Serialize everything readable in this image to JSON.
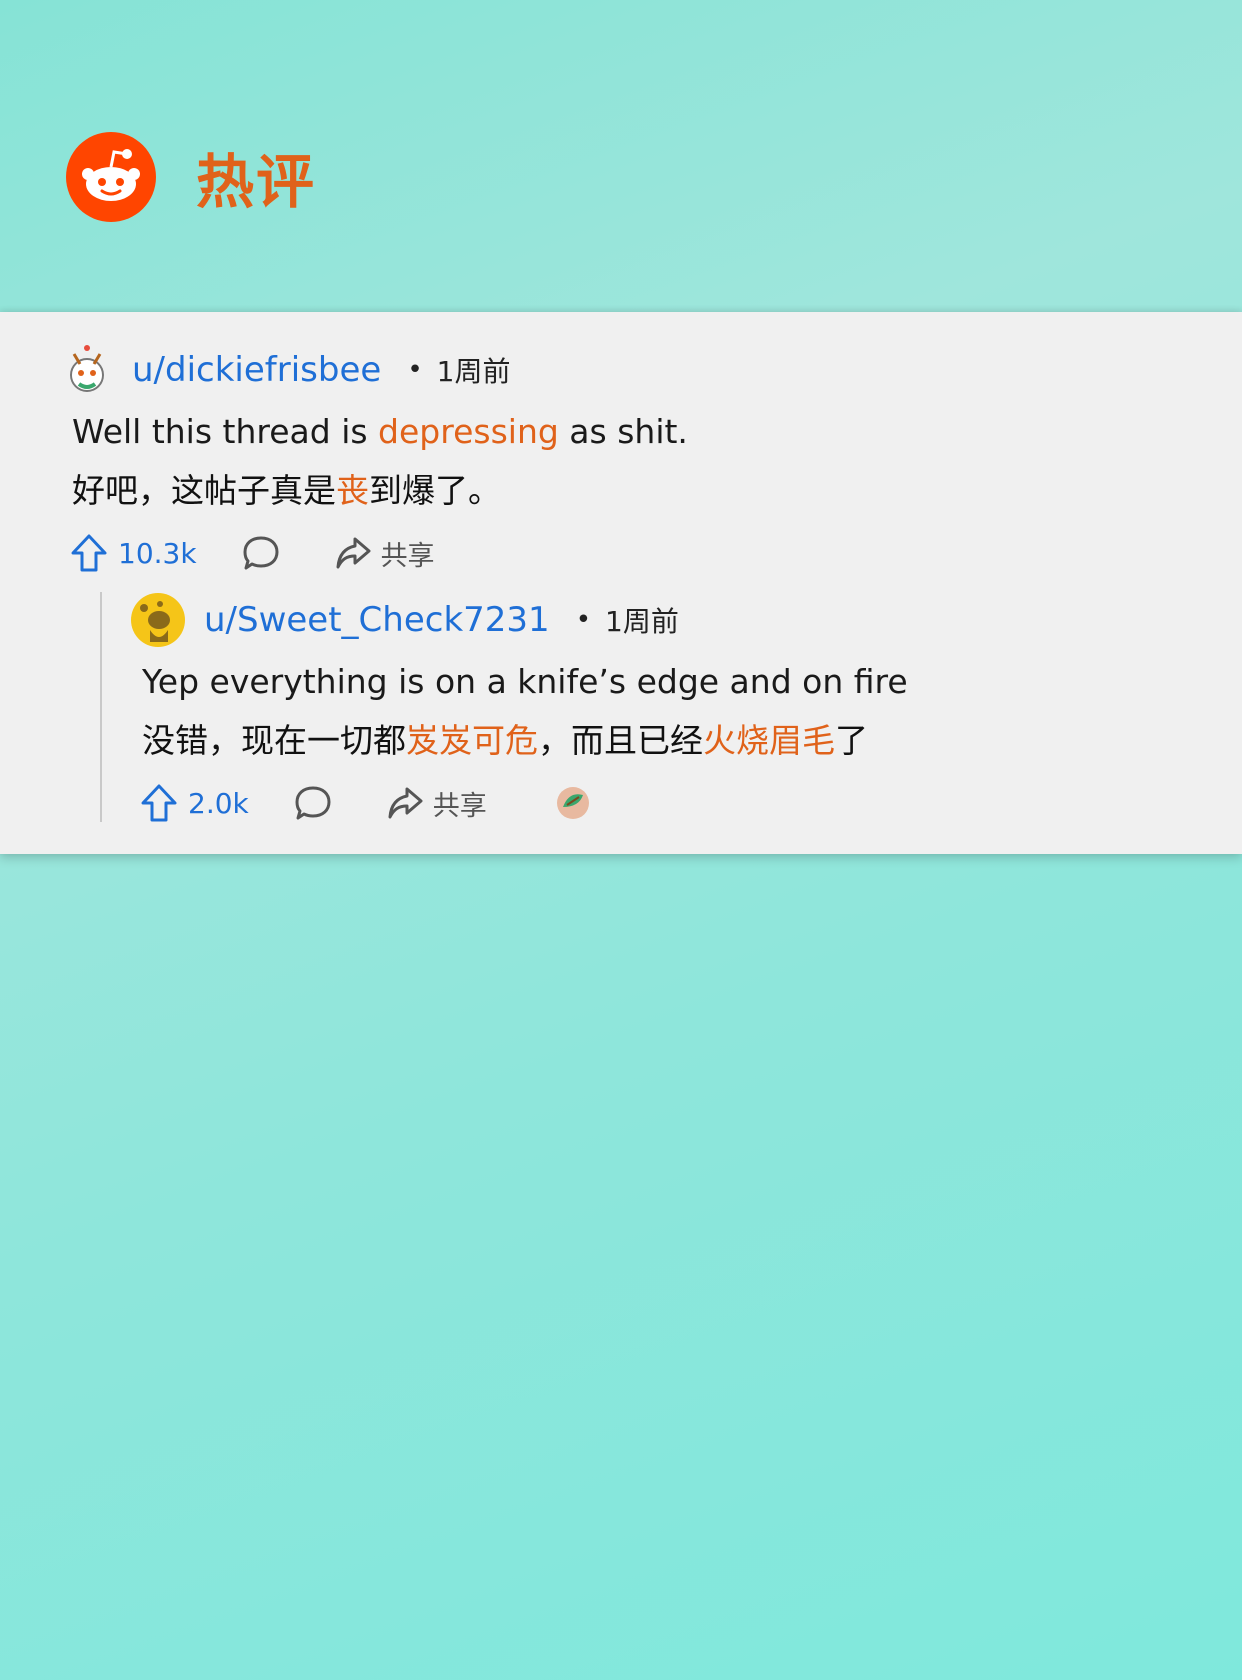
{
  "header": {
    "title": "热评"
  },
  "colors": {
    "accent": "#e0621a",
    "link": "#1f6fd6",
    "card": "#f0f0f0"
  },
  "comment": {
    "username": "u/dickiefrisbee",
    "dot": "•",
    "time": "1周前",
    "en": {
      "pre": "Well this thread is ",
      "hl": "depressing",
      "post": " as shit."
    },
    "zh": {
      "pre": "好吧，这帖子真是",
      "hl": "丧",
      "post": "到爆了。"
    },
    "upvotes": "10.3k",
    "share": "共享"
  },
  "reply": {
    "username": "u/Sweet_Check7231",
    "dot": "•",
    "time": "1周前",
    "en": "Yep everything is on a knife’s edge and on fire",
    "zh": {
      "pre": "没错，现在一切都",
      "hl1": "岌岌可危",
      "mid": "，而且已经",
      "hl2": "火烧眉毛",
      "post": "了"
    },
    "upvotes": "2.0k",
    "share": "共享"
  },
  "icons": [
    "reddit-logo-icon",
    "upvote-icon",
    "comment-icon",
    "share-icon",
    "award-icon"
  ]
}
